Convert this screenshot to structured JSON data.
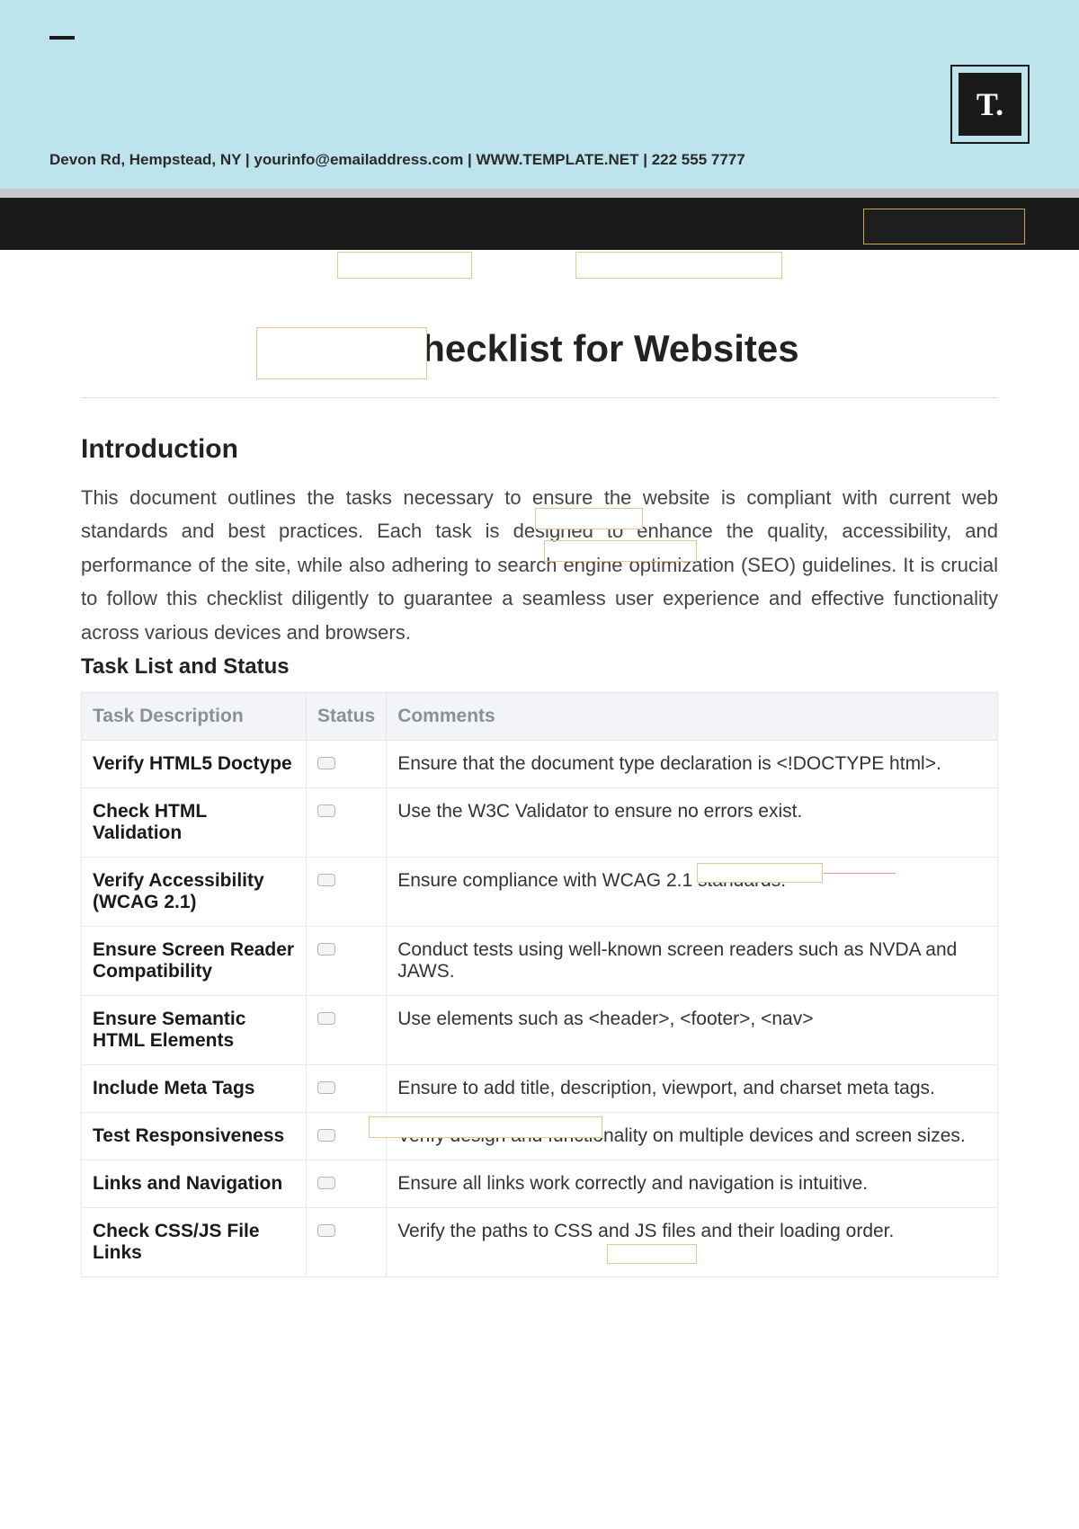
{
  "header": {
    "logo_text": "T.",
    "address_line": "Devon Rd, Hempstead, NY | yourinfo@emailaddress.com | WWW.TEMPLATE.NET | 222 555 7777"
  },
  "title": "HTML Checklist for Websites",
  "intro_heading": "Introduction",
  "intro_text": "This document outlines the tasks necessary to ensure the website is compliant with current web standards and best practices. Each task is designed to enhance the quality, accessibility, and performance of the site, while also adhering to search engine optimization (SEO) guidelines. It is crucial to follow this checklist diligently to guarantee a seamless user experience and effective functionality across various devices and browsers.",
  "tasklist_heading": "Task List and Status",
  "table": {
    "headers": {
      "c0": "Task Description",
      "c1": "Status",
      "c2": "Comments"
    },
    "rows": [
      {
        "desc": "Verify HTML5 Doctype",
        "comment": "Ensure that the document type declaration is <!DOCTYPE html>."
      },
      {
        "desc": "Check HTML Validation",
        "comment": "Use the W3C Validator to ensure no errors exist."
      },
      {
        "desc": "Verify Accessibility (WCAG 2.1)",
        "comment": "Ensure compliance with WCAG 2.1 standards."
      },
      {
        "desc": "Ensure Screen Reader Compatibility",
        "comment": "Conduct tests using well-known screen readers such as NVDA and JAWS."
      },
      {
        "desc": "Ensure Semantic HTML Elements",
        "comment": "Use elements such as <header>, <footer>, <nav>"
      },
      {
        "desc": "Include Meta Tags",
        "comment": "Ensure to add title, description, viewport, and charset meta tags."
      },
      {
        "desc": "Test Responsiveness",
        "comment": "Verify design and functionality on multiple devices and screen sizes."
      },
      {
        "desc": "Links and Navigation",
        "comment": "Ensure all links work correctly and navigation is intuitive."
      },
      {
        "desc": "Check CSS/JS File Links",
        "comment": "Verify the paths to CSS and JS files and their loading order."
      }
    ]
  }
}
